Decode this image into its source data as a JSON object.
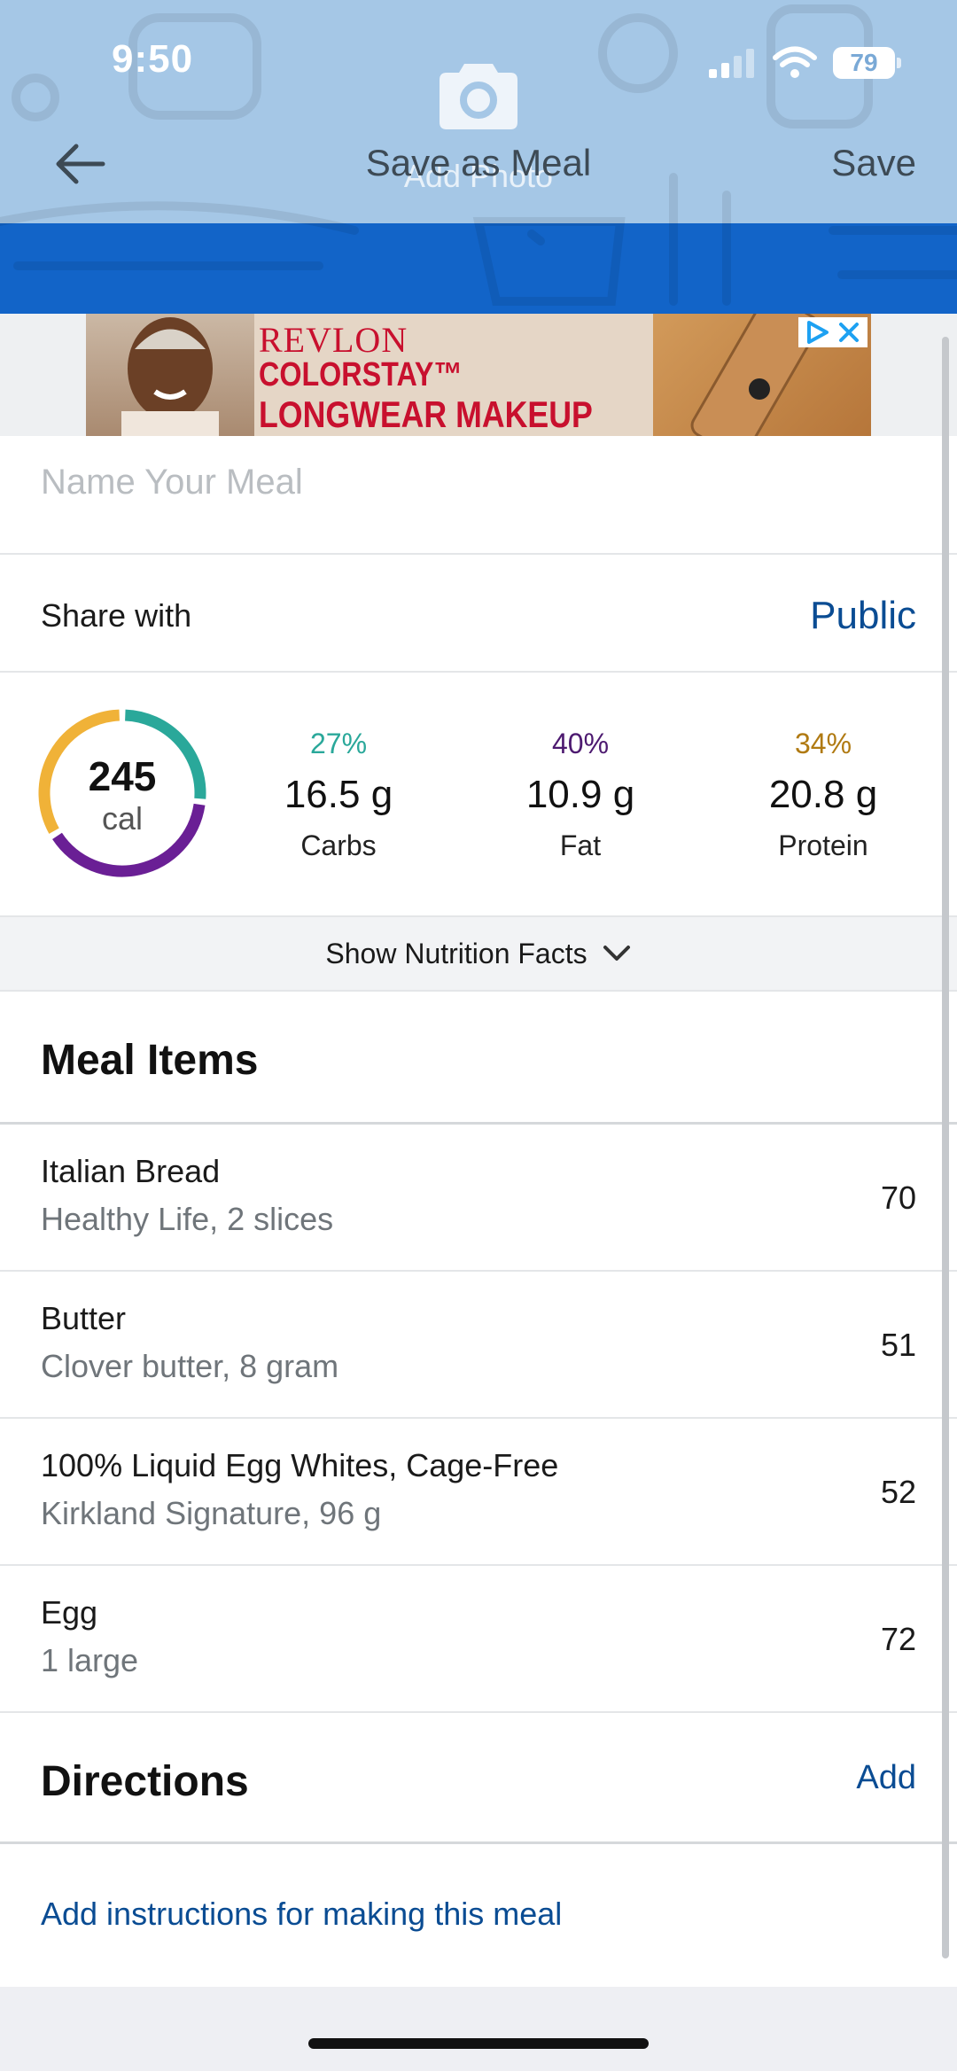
{
  "status_bar": {
    "time": "9:50",
    "battery": "79"
  },
  "nav": {
    "title": "Save as Meal",
    "photo_label": "Add Photo",
    "save_label": "Save"
  },
  "ad": {
    "brand": "REVLON",
    "line1": "COLORSTAY™",
    "line2": "LONGWEAR MAKEUP"
  },
  "meal_name": {
    "placeholder": "Name Your Meal",
    "value": ""
  },
  "share": {
    "label": "Share with",
    "value": "Public"
  },
  "summary": {
    "calories": "245",
    "calories_unit": "cal",
    "macros": [
      {
        "percent": "27%",
        "grams": "16.5 g",
        "label": "Carbs",
        "color": "#2aa89a",
        "fraction": 0.27
      },
      {
        "percent": "40%",
        "grams": "10.9 g",
        "label": "Fat",
        "color": "#6a1f95",
        "fraction": 0.4
      },
      {
        "percent": "34%",
        "grams": "20.8 g",
        "label": "Protein",
        "color": "#f0b238",
        "fraction": 0.34
      }
    ]
  },
  "nutrition_toggle": {
    "label": "Show Nutrition Facts"
  },
  "meal_items": {
    "title": "Meal Items",
    "items": [
      {
        "name": "Italian Bread",
        "detail": "Healthy Life, 2 slices",
        "calories": "70"
      },
      {
        "name": "Butter",
        "detail": "Clover butter, 8 gram",
        "calories": "51"
      },
      {
        "name": "100% Liquid Egg Whites, Cage-Free",
        "detail": "Kirkland Signature, 96 g",
        "calories": "52"
      },
      {
        "name": "Egg",
        "detail": "1 large",
        "calories": "72"
      }
    ]
  },
  "directions": {
    "title": "Directions",
    "add_label": "Add",
    "link": "Add instructions for making this meal"
  },
  "colors": {
    "accent": "#0a4c93",
    "header_blue": "#1264c8"
  }
}
